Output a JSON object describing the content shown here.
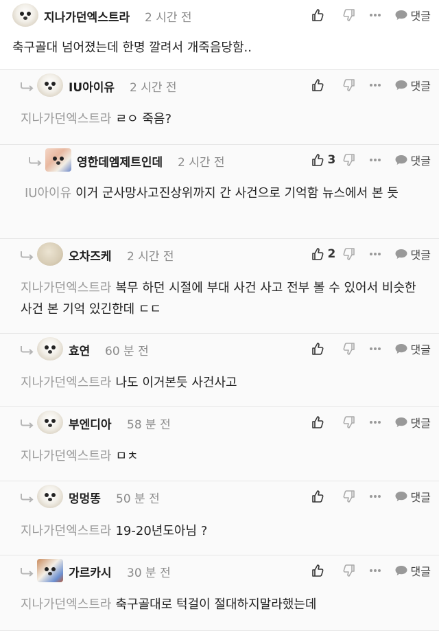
{
  "actions": {
    "reply_label": "댓글"
  },
  "icons": {
    "like": "thumbs-up-icon",
    "dislike": "thumbs-down-icon",
    "more": "more-dots-icon",
    "reply": "speech-bubble-icon",
    "reply_indent": "reply-arrow-icon"
  },
  "comments": [
    {
      "author": "지나가던엑스트라",
      "time": "2 시간 전",
      "likes": "",
      "mention": "",
      "text": "축구골대 넘어졌는데 한명 깔려서 개죽음당함..",
      "avatar": "dog"
    },
    {
      "author": "IU아이유",
      "time": "2 시간 전",
      "likes": "",
      "mention": "지나가던엑스트라",
      "text": "ㄹㅇ 죽음?",
      "avatar": "dog"
    },
    {
      "author": "영한데엠제트인데",
      "time": "2 시간 전",
      "likes": "3",
      "mention": "IU아이유",
      "text": "이거 군사망사고진상위까지 간 사건으로 기억함 뉴스에서 본 듯",
      "avatar": "photo"
    },
    {
      "author": "오차즈케",
      "time": "2 시간 전",
      "likes": "2",
      "mention": "지나가던엑스트라",
      "text": "복무 하던 시절에 부대 사건 사고 전부 볼 수 있어서 비슷한 사건 본 기억 있긴한데 ㄷㄷ",
      "avatar": "plain"
    },
    {
      "author": "효연",
      "time": "60 분 전",
      "likes": "",
      "mention": "지나가던엑스트라",
      "text": "나도 이거본듯 사건사고",
      "avatar": "dog"
    },
    {
      "author": "부엔디아",
      "time": "58 분 전",
      "likes": "",
      "mention": "지나가던엑스트라",
      "text": "ㅁㅊ",
      "avatar": "dog"
    },
    {
      "author": "멍멍똥",
      "time": "50 분 전",
      "likes": "",
      "mention": "지나가던엑스트라",
      "text": "19-20년도아님 ?",
      "avatar": "dog"
    },
    {
      "author": "가르카시",
      "time": "30 분 전",
      "likes": "",
      "mention": "지나가던엑스트라",
      "text": "축구골대로 턱걸이 절대하지말라했는데",
      "avatar": "photo2"
    }
  ]
}
